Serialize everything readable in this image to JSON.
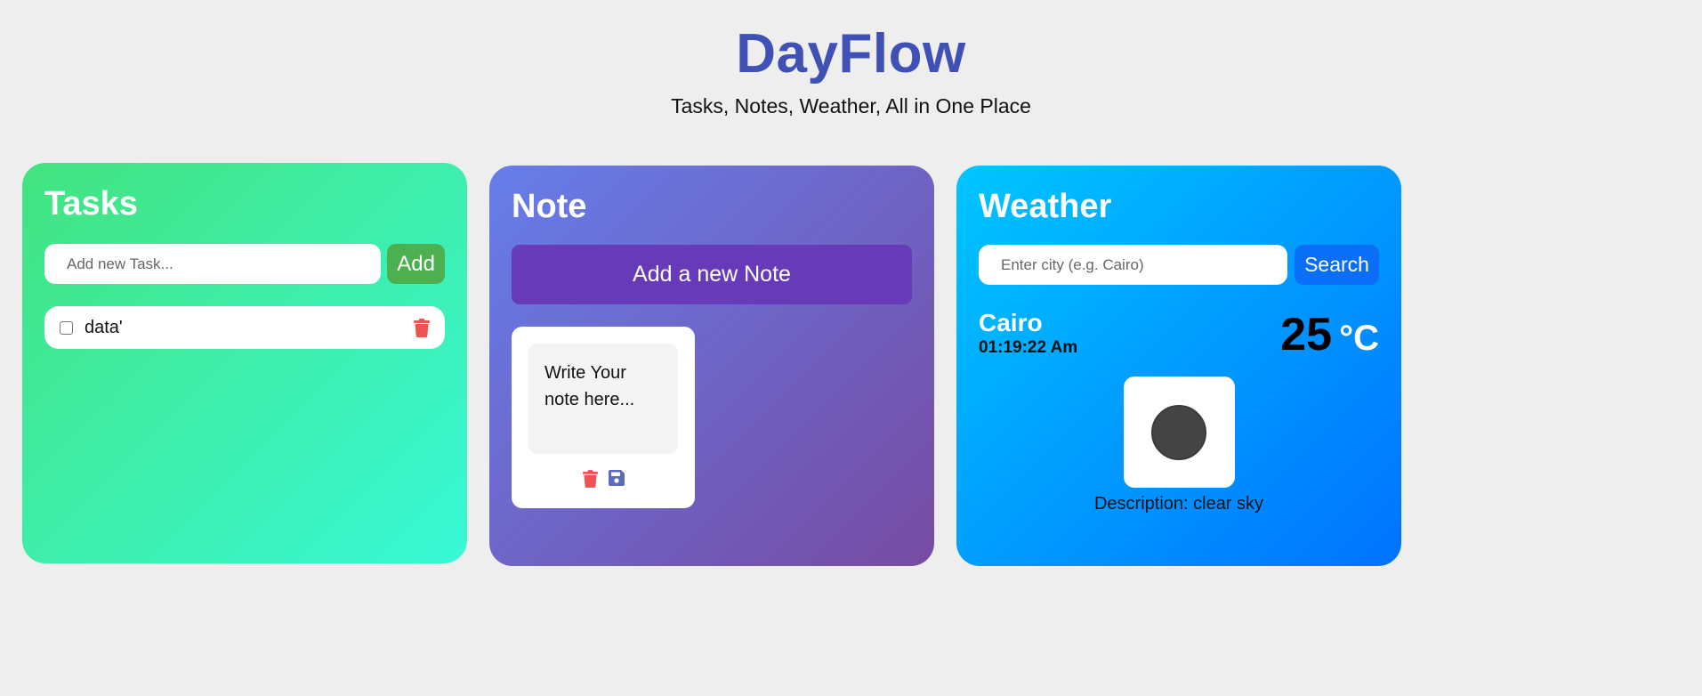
{
  "header": {
    "title": "DayFlow",
    "subtitle": "Tasks, Notes, Weather, All in One Place"
  },
  "tasks": {
    "title": "Tasks",
    "input_placeholder": "Add new Task...",
    "add_label": "Add",
    "items": [
      {
        "text": "data'",
        "checked": false
      }
    ]
  },
  "note": {
    "title": "Note",
    "add_label": "Add a new Note",
    "items": [
      {
        "text": "Write Your note here..."
      }
    ]
  },
  "weather": {
    "title": "Weather",
    "input_placeholder": "Enter city (e.g. Cairo)",
    "search_label": "Search",
    "city": "Cairo",
    "time": "01:19:22 Am",
    "temperature": "25",
    "unit": "°C",
    "description": "Description: clear sky"
  },
  "colors": {
    "title": "#3f51b5",
    "tasks_gradient": [
      "#43e97b",
      "#38f9d7"
    ],
    "note_gradient": [
      "#667eea",
      "#764ba2"
    ],
    "weather_gradient": [
      "#00c6ff",
      "#0072ff"
    ],
    "add_button": "#4caf50",
    "new_note_button": "#673ab7",
    "search_button": "#0a6ff6",
    "delete_icon": "#ef5350",
    "save_icon": "#5c6bc0"
  }
}
